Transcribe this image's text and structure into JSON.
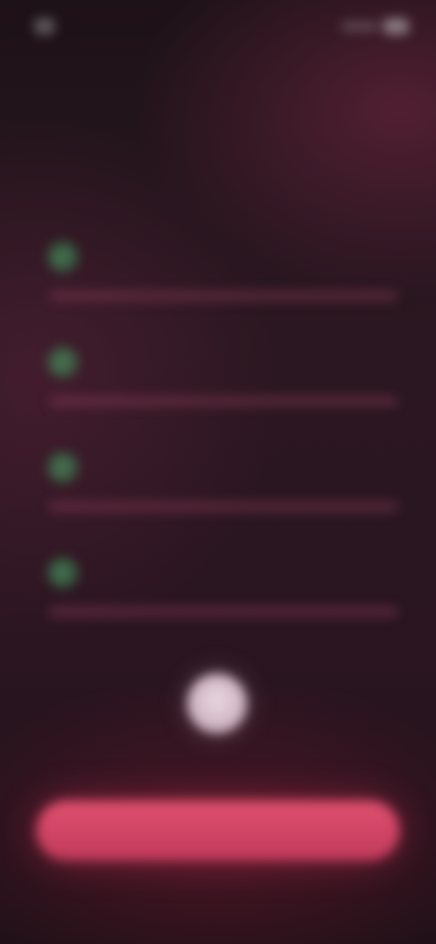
{
  "status_bar": {
    "time": "",
    "icons": [
      "signal-icon",
      "battery-icon"
    ]
  },
  "header": {
    "title": "",
    "subtitle": ""
  },
  "checklist": {
    "items": [
      {
        "title": "",
        "subtitle": "",
        "value": "",
        "checked": true
      },
      {
        "title": "",
        "subtitle": "",
        "value": "",
        "checked": true
      },
      {
        "title": "",
        "subtitle": "",
        "value": "",
        "checked": true
      },
      {
        "title": "",
        "subtitle": "",
        "value": "",
        "checked": true
      }
    ]
  },
  "footer": {
    "note": "",
    "cta_label": ""
  },
  "colors": {
    "background": "#2a1520",
    "accent": "#d94468",
    "check": "#3c965a"
  }
}
